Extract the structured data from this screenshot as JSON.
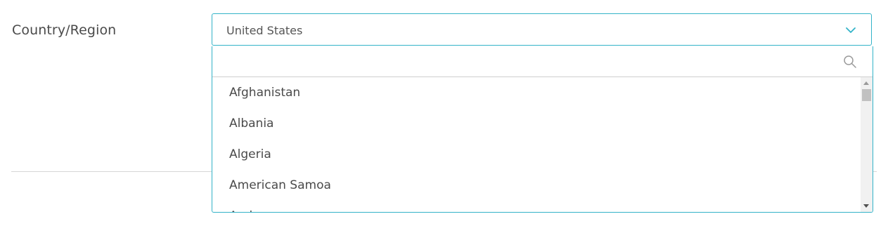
{
  "field": {
    "label": "Country/Region",
    "selected_value": "United States"
  },
  "dropdown": {
    "search_placeholder": "",
    "options": [
      "Afghanistan",
      "Albania",
      "Algeria",
      "American Samoa",
      "Andorra"
    ]
  },
  "colors": {
    "accent": "#33b3c8",
    "text": "#4a4a4a",
    "divider": "#d6d6d6"
  },
  "icons": {
    "select": "chevron-down-icon",
    "search": "search-icon"
  }
}
